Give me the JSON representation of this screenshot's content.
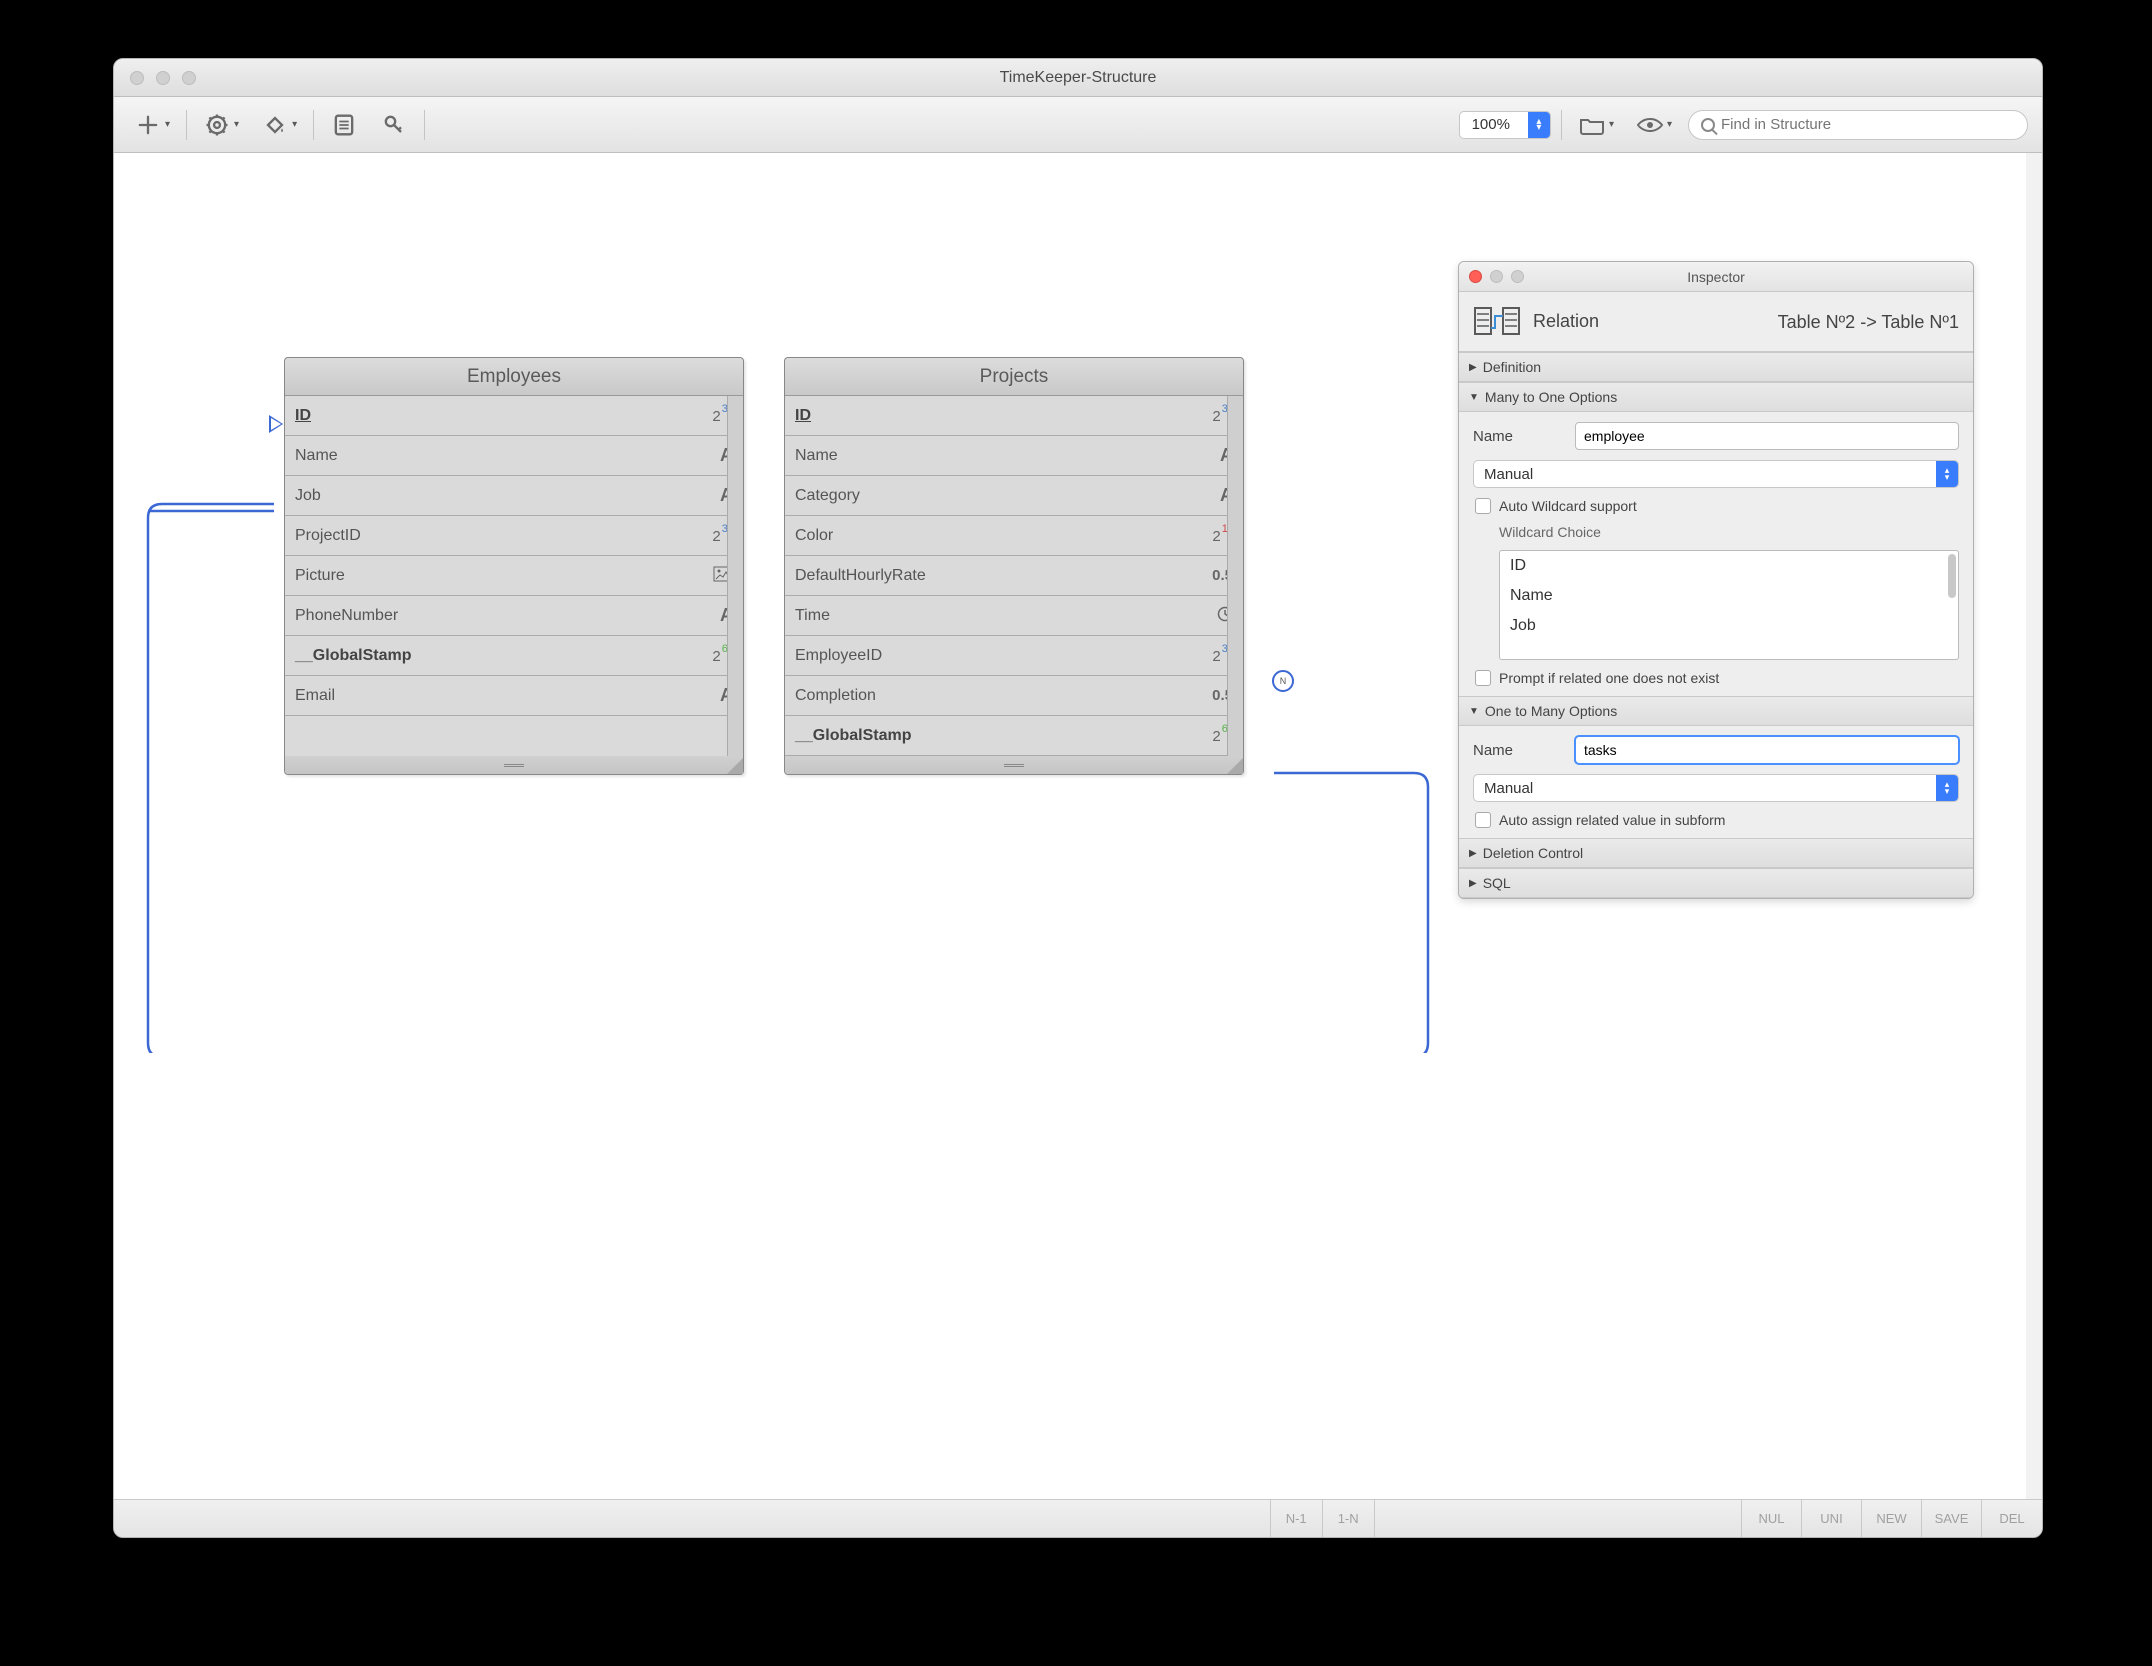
{
  "window": {
    "title": "TimeKeeper-Structure"
  },
  "toolbar": {
    "zoom": "100%",
    "search_placeholder": "Find in Structure"
  },
  "tables": {
    "employees": {
      "title": "Employees",
      "fields": [
        {
          "name": "ID",
          "type": "int32",
          "pk": true
        },
        {
          "name": "Name",
          "type": "alpha"
        },
        {
          "name": "Job",
          "type": "alpha"
        },
        {
          "name": "ProjectID",
          "type": "int32"
        },
        {
          "name": "Picture",
          "type": "picture"
        },
        {
          "name": "PhoneNumber",
          "type": "alpha"
        },
        {
          "name": "__GlobalStamp",
          "type": "int64",
          "bold": true
        },
        {
          "name": "Email",
          "type": "alpha"
        }
      ]
    },
    "projects": {
      "title": "Projects",
      "fields": [
        {
          "name": "ID",
          "type": "int32",
          "pk": true
        },
        {
          "name": "Name",
          "type": "alpha"
        },
        {
          "name": "Category",
          "type": "alpha"
        },
        {
          "name": "Color",
          "type": "int16"
        },
        {
          "name": "DefaultHourlyRate",
          "type": "real"
        },
        {
          "name": "Time",
          "type": "time"
        },
        {
          "name": "EmployeeID",
          "type": "int32"
        },
        {
          "name": "Completion",
          "type": "real"
        },
        {
          "name": "__GlobalStamp",
          "type": "int64",
          "bold": true
        }
      ]
    }
  },
  "inspector": {
    "title": "Inspector",
    "header_label": "Relation",
    "header_sub": "Table Nº2 -> Table Nº1",
    "sections": {
      "definition": "Definition",
      "mto": {
        "title": "Many to One Options",
        "name_label": "Name",
        "name_value": "employee",
        "mode": "Manual",
        "auto_wildcard": "Auto Wildcard support",
        "wildcard_label": "Wildcard Choice",
        "wildcard_items": [
          "ID",
          "Name",
          "Job"
        ],
        "prompt": "Prompt if related one does not exist"
      },
      "otm": {
        "title": "One to Many Options",
        "name_label": "Name",
        "name_value": "tasks",
        "mode": "Manual",
        "auto_assign": "Auto assign related value in subform"
      },
      "deletion": "Deletion Control",
      "sql": "SQL"
    }
  },
  "statusbar": {
    "rel1": "N-1",
    "rel2": "1-N",
    "flags": [
      "NUL",
      "UNI",
      "NEW",
      "SAVE",
      "DEL"
    ]
  }
}
